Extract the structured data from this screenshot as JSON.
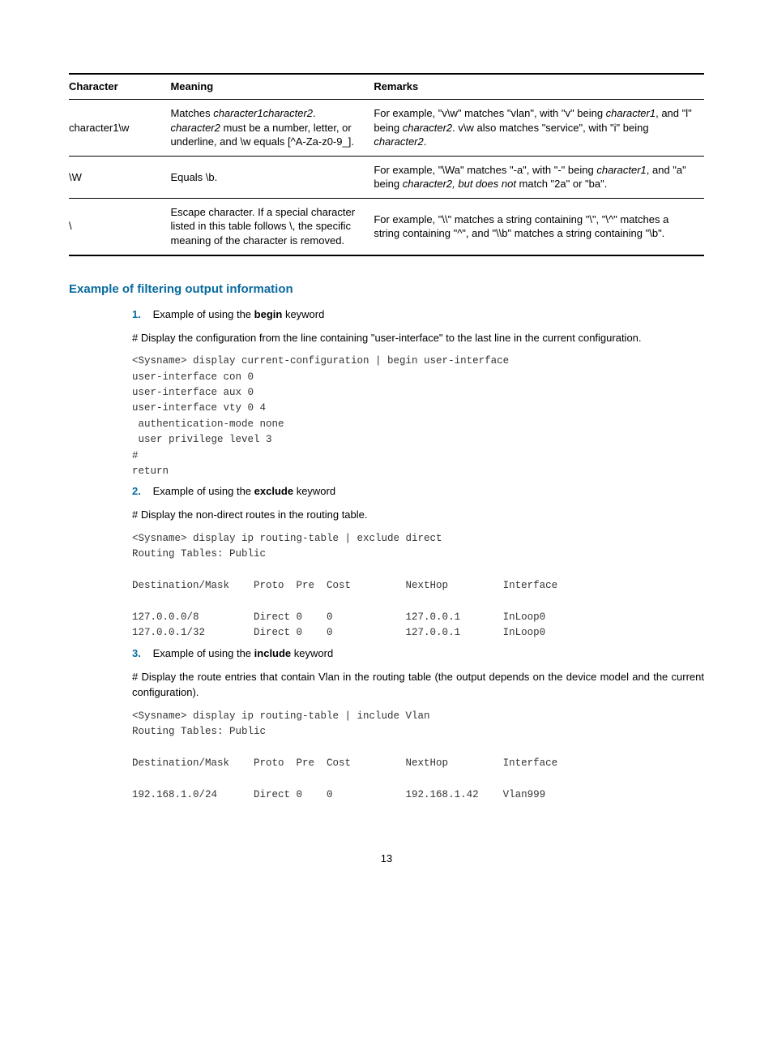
{
  "table": {
    "headers": [
      "Character",
      "Meaning",
      "Remarks"
    ],
    "rows": [
      {
        "char": "character1\\w",
        "meaning_html": "Matches <span class='italic'>character1character2</span>. <span class='italic'>character2</span> must be a number, letter, or underline, and \\w equals [^A-Za-z0-9_].",
        "remarks_html": "For example, \"v\\w\" matches \"vlan\", with \"v\" being <span class='italic'>character1</span>, and \"l\" being <span class='italic'>character2</span>. v\\w also matches \"service\", with \"i\" being <span class='italic'>character2</span>."
      },
      {
        "char": "\\W",
        "meaning_html": "Equals \\b.",
        "remarks_html": "For example, \"\\Wa\" matches \"-a\", with \"-\" being <span class='italic'>character1</span>, and \"a\" being <span class='italic'>character2, but does not</span> match \"2a\" or \"ba\"."
      },
      {
        "char": "\\",
        "meaning_html": "Escape character. If a special character listed in this table follows \\, the specific meaning of the character is removed.",
        "remarks_html": "For example, \"\\\\\" matches a string containing \"\\\", \"\\^\" matches a string containing \"^\", and \"\\\\b\" matches a string containing \"\\b\"."
      }
    ]
  },
  "section_heading": "Example of filtering output information",
  "step1": {
    "num": "1.",
    "text_pre": "Example of using the ",
    "kw": "begin",
    "text_post": " keyword"
  },
  "para1": "# Display the configuration from the line containing \"user-interface\" to the last line in the current configuration.",
  "code1": "<Sysname> display current-configuration | begin user-interface\nuser-interface con 0\nuser-interface aux 0\nuser-interface vty 0 4\n authentication-mode none\n user privilege level 3\n#\nreturn",
  "step2": {
    "num": "2.",
    "text_pre": "Example of using the ",
    "kw": "exclude",
    "text_post": " keyword"
  },
  "para2": "# Display the non-direct routes in the routing table.",
  "code2": "<Sysname> display ip routing-table | exclude direct\nRouting Tables: Public\n\nDestination/Mask    Proto  Pre  Cost         NextHop         Interface\n\n127.0.0.0/8         Direct 0    0            127.0.0.1       InLoop0\n127.0.0.1/32        Direct 0    0            127.0.0.1       InLoop0",
  "step3": {
    "num": "3.",
    "text_pre": "Example of using the ",
    "kw": "include",
    "text_post": " keyword"
  },
  "para3": "# Display the route entries that contain Vlan in the routing table (the output depends on the device model and the current configuration).",
  "code3": "<Sysname> display ip routing-table | include Vlan\nRouting Tables: Public\n\nDestination/Mask    Proto  Pre  Cost         NextHop         Interface\n\n192.168.1.0/24      Direct 0    0            192.168.1.42    Vlan999",
  "page_number": "13"
}
